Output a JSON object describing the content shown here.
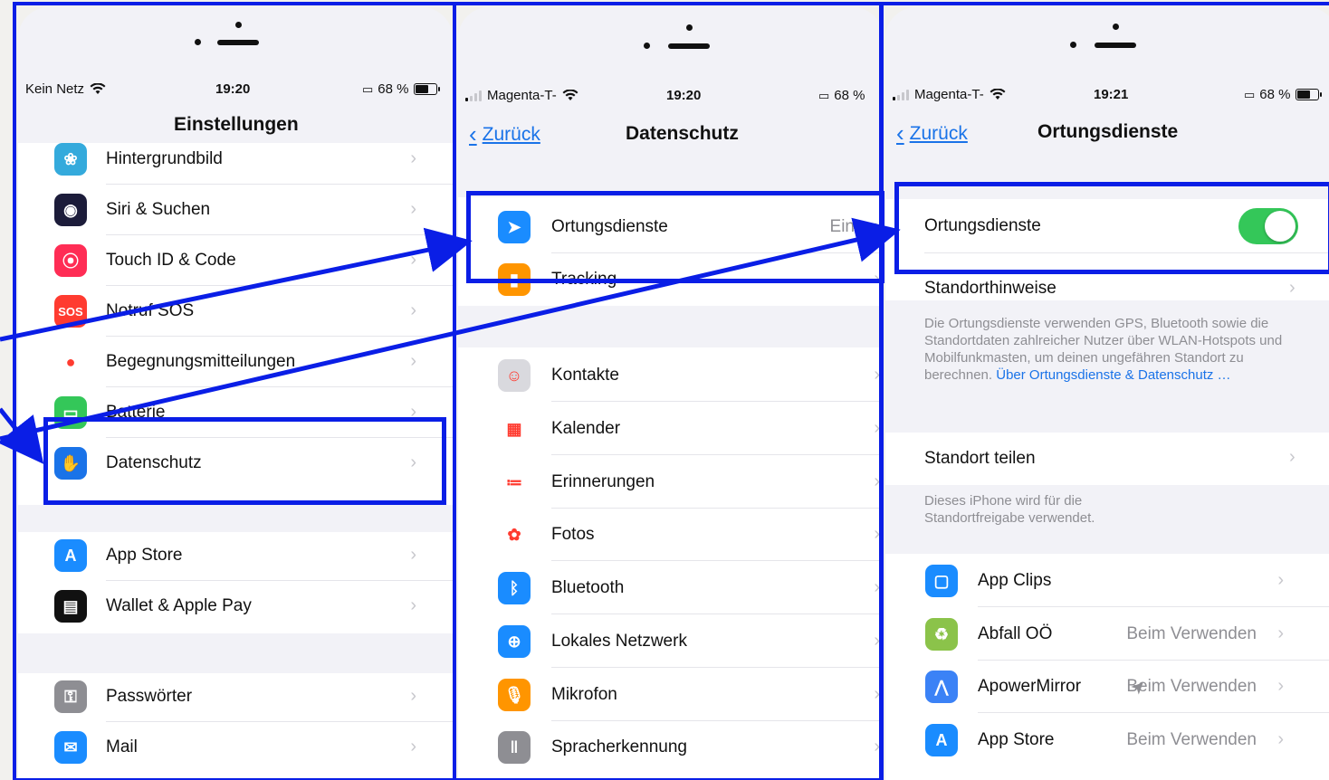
{
  "accent_color": "#0a1ee6",
  "screen1": {
    "status": {
      "carrier": "Kein Netz",
      "time": "19:20",
      "battery": "68 %"
    },
    "title": "Einstellungen",
    "groups": [
      [
        {
          "label": "Hintergrundbild",
          "icon": "wallpaper-icon",
          "color": "#34aadc"
        },
        {
          "label": "Siri & Suchen",
          "icon": "siri-icon",
          "color": "#1c1c3a"
        },
        {
          "label": "Touch ID & Code",
          "icon": "fingerprint-icon",
          "color": "#ff2d55"
        },
        {
          "label": "Notruf SOS",
          "icon": "sos-icon",
          "color": "#ff3b30",
          "glyph": "SOS"
        },
        {
          "label": "Begegnungsmitteilungen",
          "icon": "exposure-icon",
          "color": "#ffffff"
        },
        {
          "label": "Batterie",
          "icon": "battery-icon",
          "color": "#34c759"
        },
        {
          "label": "Datenschutz",
          "icon": "hand-icon",
          "color": "#1a73e8"
        }
      ],
      [
        {
          "label": "App Store",
          "icon": "app-store-icon",
          "color": "#1a8cff"
        },
        {
          "label": "Wallet & Apple Pay",
          "icon": "wallet-icon",
          "color": "#111111"
        }
      ],
      [
        {
          "label": "Passwörter",
          "icon": "key-icon",
          "color": "#8e8e93"
        },
        {
          "label": "Mail",
          "icon": "mail-icon",
          "color": "#1a8cff"
        }
      ]
    ]
  },
  "screen2": {
    "status": {
      "carrier": "Magenta-T-",
      "time": "19:20",
      "battery": "68 %"
    },
    "back": "Zurück",
    "title": "Datenschutz",
    "groups": [
      [
        {
          "label": "Ortungsdienste",
          "value": "Ein",
          "icon": "location-icon",
          "color": "#1a8cff"
        },
        {
          "label": "Tracking",
          "icon": "tracking-icon",
          "color": "#ff9500"
        }
      ],
      [
        {
          "label": "Kontakte",
          "icon": "contacts-icon",
          "color": "#d9d9de"
        },
        {
          "label": "Kalender",
          "icon": "calendar-icon",
          "color": "#ffffff"
        },
        {
          "label": "Erinnerungen",
          "icon": "reminders-icon",
          "color": "#ffffff"
        },
        {
          "label": "Fotos",
          "icon": "photos-icon",
          "color": "#ffffff"
        },
        {
          "label": "Bluetooth",
          "icon": "bluetooth-icon",
          "color": "#1a8cff"
        },
        {
          "label": "Lokales Netzwerk",
          "icon": "globe-icon",
          "color": "#1a8cff"
        },
        {
          "label": "Mikrofon",
          "icon": "microphone-icon",
          "color": "#ff9500"
        },
        {
          "label": "Spracherkennung",
          "icon": "waveform-icon",
          "color": "#8e8e93"
        }
      ]
    ]
  },
  "screen3": {
    "status": {
      "carrier": "Magenta-T-",
      "time": "19:21",
      "battery": "68 %"
    },
    "back": "Zurück",
    "title": "Ortungsdienste",
    "toggle_label": "Ortungsdienste",
    "toggle_on": true,
    "hints_label": "Standorthinweise",
    "description": "Die Ortungsdienste verwenden GPS, Bluetooth sowie die Standortdaten zahlreicher Nutzer über WLAN-Hotspots und Mobilfunkmasten, um deinen ungefähren Standort zu berechnen.",
    "description_link": "Über Ortungsdienste & Datenschutz …",
    "share_label": "Standort teilen",
    "share_note": "Dieses iPhone wird für die Standortfreigabe verwendet.",
    "apps": [
      {
        "label": "App Clips",
        "value": "",
        "icon": "app-clips-icon",
        "color": "#1a8cff"
      },
      {
        "label": "Abfall OÖ",
        "value": "Beim Verwenden",
        "icon": "abfall-icon",
        "color": "#8bc34a"
      },
      {
        "label": "ApowerMirror",
        "value": "Beim Verwenden",
        "icon": "apowermirror-icon",
        "color": "#3b82f6",
        "arrow": true
      },
      {
        "label": "App Store",
        "value": "Beim Verwenden",
        "icon": "app-store-icon",
        "color": "#1a8cff"
      }
    ]
  }
}
